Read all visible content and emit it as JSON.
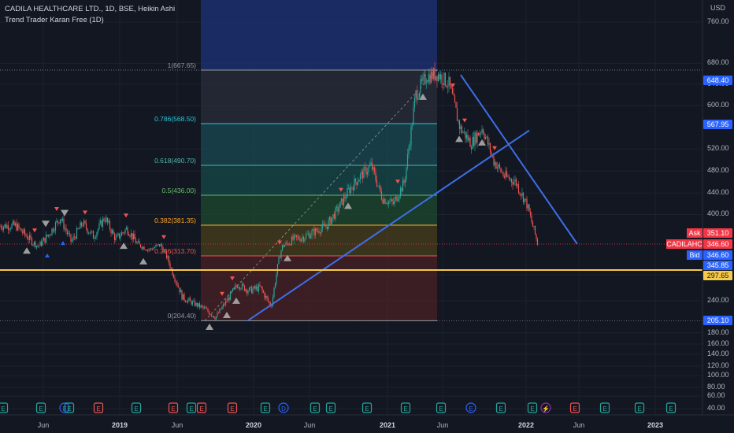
{
  "header": {
    "symbol_line": "CADILA HEALTHCARE LTD., 1D, BSE, Heikin Ashi",
    "indicator_line": "Trend Trader Karan Free (1D)"
  },
  "currency": "USD",
  "colors": {
    "background": "#131722",
    "up": "#26a69a",
    "down": "#ef5350",
    "trendline": "#3d6ee8",
    "support": "#f7c948",
    "last_price": "#f23645",
    "axis_highlight": "#2962ff"
  },
  "price_tags": {
    "p648": "648.40",
    "p567": "567.95",
    "ask_label": "Ask",
    "ask": "351.10",
    "symbol_label": "CADILAHC",
    "last": "346.60",
    "bid_label": "Bid",
    "bid": "346.60",
    "p345": "345.85",
    "p297": "297.65",
    "p205": "205.10"
  },
  "chart_data": {
    "type": "candlestick",
    "title": "CADILA HEALTHCARE LTD., 1D, BSE, Heikin Ashi",
    "y_axis": {
      "ticks": [
        40,
        60,
        80,
        100,
        120,
        140,
        160,
        180,
        240,
        280,
        400,
        440,
        480,
        520,
        600,
        640,
        680,
        760
      ],
      "tick_labels": [
        "40.00",
        "60.00",
        "80.00",
        "100.00",
        "120.00",
        "140.00",
        "160.00",
        "180.00",
        "240.00",
        "280.00",
        "400.00",
        "440.00",
        "480.00",
        "520.00",
        "600.00",
        "640.00",
        "680.00",
        "760.00"
      ],
      "scale": "log"
    },
    "x_axis": {
      "labels": [
        "Jun",
        "2019",
        "Jun",
        "2020",
        "Jun",
        "2021",
        "Jun",
        "2022",
        "Jun",
        "2023"
      ],
      "bold": [
        "2019",
        "2020",
        "2021",
        "2022",
        "2023"
      ]
    },
    "price_path": [
      [
        "2018-04",
        380
      ],
      [
        "2018-05",
        360
      ],
      [
        "2018-06",
        340
      ],
      [
        "2018-07",
        365
      ],
      [
        "2018-08",
        395
      ],
      [
        "2018-09",
        350
      ],
      [
        "2018-10",
        385
      ],
      [
        "2018-11",
        360
      ],
      [
        "2018-12",
        395
      ],
      [
        "2019-01",
        355
      ],
      [
        "2019-02",
        375
      ],
      [
        "2019-03",
        345
      ],
      [
        "2019-04",
        330
      ],
      [
        "2019-05",
        345
      ],
      [
        "2019-06",
        290
      ],
      [
        "2019-07",
        245
      ],
      [
        "2019-08",
        235
      ],
      [
        "2019-09",
        225
      ],
      [
        "2019-10",
        210
      ],
      [
        "2019-11",
        240
      ],
      [
        "2019-12",
        265
      ],
      [
        "2020-01",
        255
      ],
      [
        "2020-02",
        260
      ],
      [
        "2020-03",
        230
      ],
      [
        "2020-04",
        340
      ],
      [
        "2020-05",
        355
      ],
      [
        "2020-06",
        360
      ],
      [
        "2020-07",
        370
      ],
      [
        "2020-08",
        380
      ],
      [
        "2020-09",
        410
      ],
      [
        "2020-10",
        445
      ],
      [
        "2020-11",
        470
      ],
      [
        "2020-12",
        490
      ],
      [
        "2021-01",
        430
      ],
      [
        "2021-02",
        420
      ],
      [
        "2021-03",
        460
      ],
      [
        "2021-04",
        620
      ],
      [
        "2021-05",
        655
      ],
      [
        "2021-06",
        660
      ],
      [
        "2021-07",
        640
      ],
      [
        "2021-08",
        560
      ],
      [
        "2021-09",
        530
      ],
      [
        "2021-10",
        560
      ],
      [
        "2021-11",
        500
      ],
      [
        "2021-12",
        470
      ],
      [
        "2022-01",
        460
      ],
      [
        "2022-02",
        420
      ],
      [
        "2022-03",
        346.6
      ]
    ],
    "fibonacci": [
      {
        "level": "1",
        "price": 667.65,
        "label": "1(667.65)",
        "color": "#9598a1"
      },
      {
        "level": "0.786",
        "price": 568.5,
        "label": "0.786(568.50)",
        "color": "#26c6da"
      },
      {
        "level": "0.618",
        "price": 490.7,
        "label": "0.618(490.70)",
        "color": "#4db6ac"
      },
      {
        "level": "0.5",
        "price": 436.0,
        "label": "0.5(436.00)",
        "color": "#66bb6a"
      },
      {
        "level": "0.382",
        "price": 381.35,
        "label": "0.382(381.35)",
        "color": "#ffa726"
      },
      {
        "level": "0.236",
        "price": 313.7,
        "label": "0.236(313.70)",
        "color": "#ef5350"
      },
      {
        "level": "0",
        "price": 204.4,
        "label": "0(204.40)",
        "color": "#9598a1"
      }
    ],
    "last_price": 346.6,
    "support_level": 297.65
  },
  "event_markers": [
    "E",
    "E",
    "E",
    "E",
    "D",
    "E",
    "E",
    "E",
    "E",
    "E",
    "E",
    "E",
    "E",
    "E",
    "E",
    "D",
    "E",
    "E",
    "E",
    "E",
    "E",
    "E",
    "E",
    "E",
    "E",
    "E",
    "E",
    "E",
    "E",
    "E",
    "E",
    "E",
    "E"
  ]
}
